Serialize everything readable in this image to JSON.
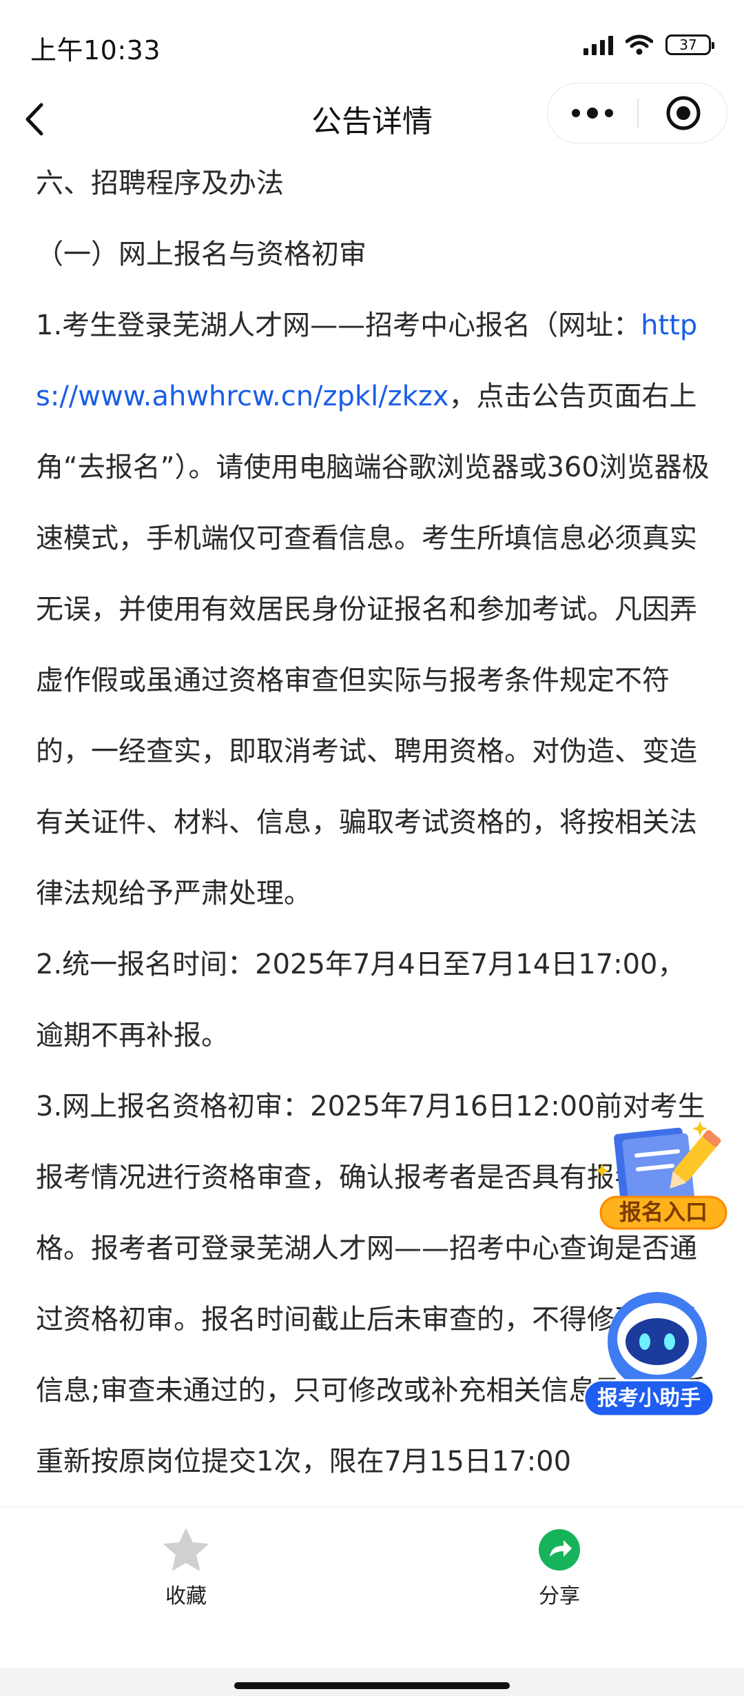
{
  "status_bar": {
    "time": "上午10:33",
    "battery": "37"
  },
  "nav": {
    "title": "公告详情",
    "back_icon": "chevron-left-icon",
    "more_icon": "more-dots-icon",
    "close_icon": "target-close-icon"
  },
  "article": {
    "section_heading": "六、招聘程序及办法",
    "sub_heading": "（一）网上报名与资格初审",
    "item1_prefix": "1.考生登录芜湖人才网——招考中心报名（网址：",
    "item1_link": "https://www.ahwhrcw.cn/zpkl/zkzx",
    "item1_suffix": "，点击公告页面右上角“去报名”）。请使用电脑端谷歌浏览器或360浏览器极速模式，手机端仅可查看信息。考生所填信息必须真实无误，并使用有效居民身份证报名和参加考试。凡因弄虚作假或虽通过资格审查但实际与报考条件规定不符的，一经查实，即取消考试、聘用资格。对伪造、变造有关证件、材料、信息，骗取考试资格的，将按相关法律法规给予严肃处理。",
    "item2": "2.统一报名时间：2025年7月4日至7月14日17:00，逾期不再补报。",
    "item3": "3.网上报名资格初审：2025年7月16日12:00前对考生报考情况进行资格审查，确认报考者是否具有报考资格。报考者可登录芜湖人才网——招考中心查询是否通过资格初审。报名时间截止后未审查的，不得修改报考信息;审查未通过的，只可修改或补充相关信息及材料后重新按原岗位提交1次，限在7月15日17:00"
  },
  "floating": {
    "signup_label": "报名入口",
    "assistant_label": "报考小助手"
  },
  "bottom_bar": {
    "favorite_label": "收藏",
    "favorite_icon": "star-icon",
    "share_label": "分享",
    "share_icon": "share-arrow-icon"
  },
  "colors": {
    "link": "#1a5ee6",
    "share_green": "#17b35a",
    "assistant_blue": "#1f5ef0",
    "signup_orange": "#f5a21a"
  }
}
